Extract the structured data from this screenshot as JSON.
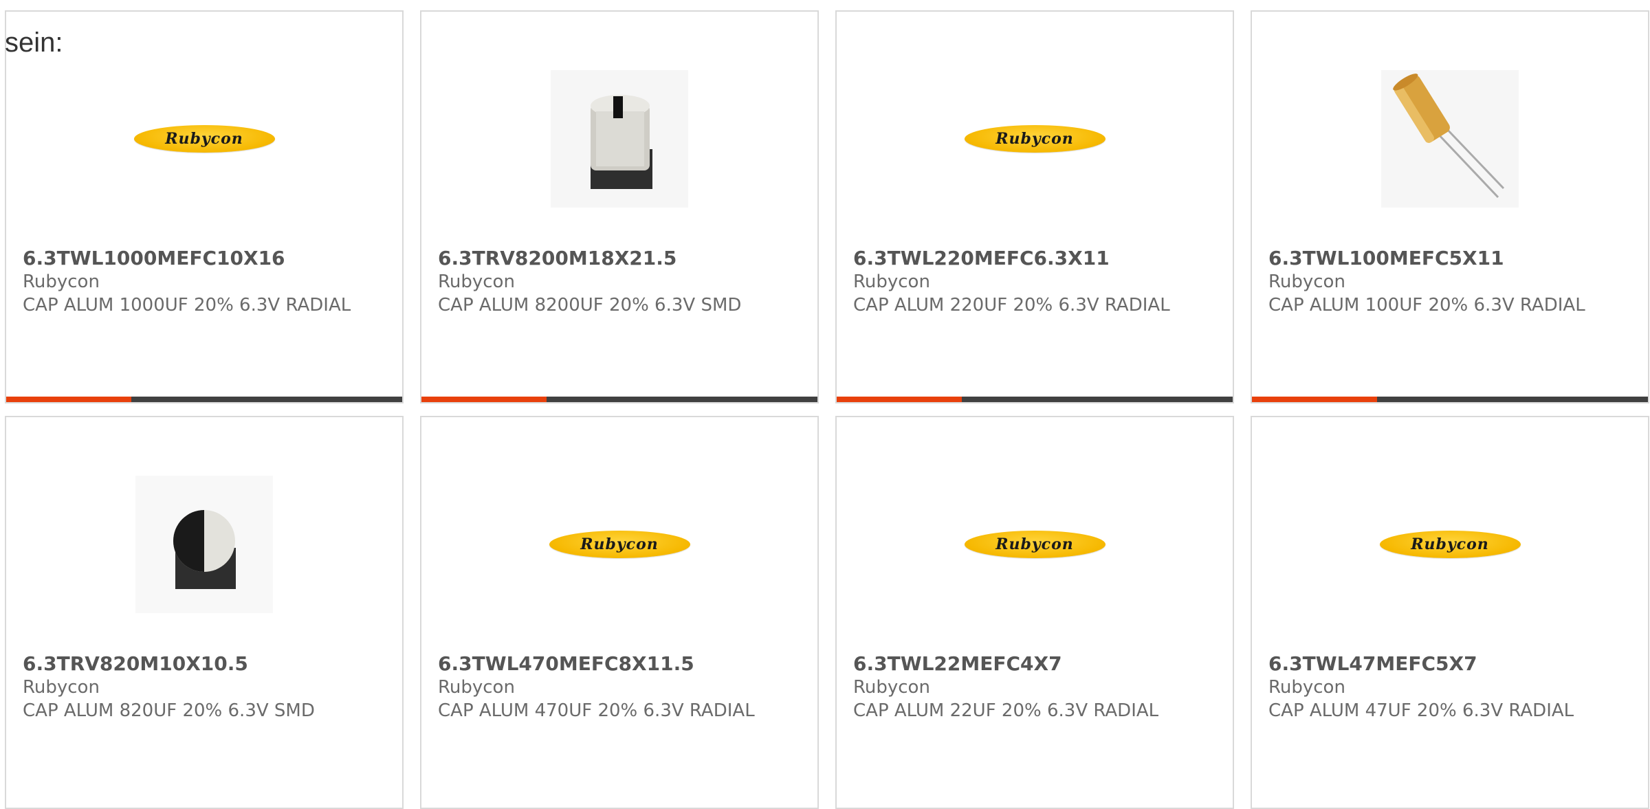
{
  "page": {
    "heading": "sein:"
  },
  "colors": {
    "accent": "#e8400c",
    "bar": "#404040",
    "border": "#d9d9d9"
  },
  "products": [
    {
      "part": "6.3TWL1000MEFC10X16",
      "maker": "Rubycon",
      "desc": "CAP ALUM 1000UF 20% 6.3V RADIAL",
      "image": "rubycon-logo",
      "logo_text": "Rubycon"
    },
    {
      "part": "6.3TRV8200M18X21.5",
      "maker": "Rubycon",
      "desc": "CAP ALUM 8200UF 20% 6.3V SMD",
      "image": "smd-capacitor-photo-front"
    },
    {
      "part": "6.3TWL220MEFC6.3X11",
      "maker": "Rubycon",
      "desc": "CAP ALUM 220UF 20% 6.3V RADIAL",
      "image": "rubycon-logo",
      "logo_text": "Rubycon"
    },
    {
      "part": "6.3TWL100MEFC5X11",
      "maker": "Rubycon",
      "desc": "CAP ALUM 100UF 20% 6.3V RADIAL",
      "image": "radial-capacitor-photo"
    },
    {
      "part": "6.3TRV820M10X10.5",
      "maker": "Rubycon",
      "desc": "CAP ALUM 820UF 20% 6.3V SMD",
      "image": "smd-capacitor-photo-top"
    },
    {
      "part": "6.3TWL470MEFC8X11.5",
      "maker": "Rubycon",
      "desc": "CAP ALUM 470UF 20% 6.3V RADIAL",
      "image": "rubycon-logo",
      "logo_text": "Rubycon"
    },
    {
      "part": "6.3TWL22MEFC4X7",
      "maker": "Rubycon",
      "desc": "CAP ALUM 22UF 20% 6.3V RADIAL",
      "image": "rubycon-logo",
      "logo_text": "Rubycon"
    },
    {
      "part": "6.3TWL47MEFC5X7",
      "maker": "Rubycon",
      "desc": "CAP ALUM 47UF 20% 6.3V RADIAL",
      "image": "rubycon-logo",
      "logo_text": "Rubycon"
    }
  ]
}
